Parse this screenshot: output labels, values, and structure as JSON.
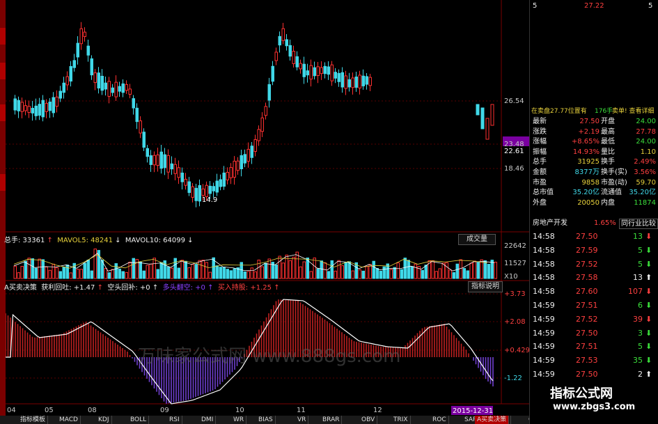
{
  "chart": {
    "price_levels": [
      "26.54",
      "23.48",
      "22.61",
      "18.46"
    ],
    "low_marker": "14.9",
    "date_labels": [
      "04",
      "05",
      "08",
      "09",
      "10",
      "11",
      "12"
    ],
    "date_badge": "2015-12-31",
    "bottom_tag": "A买卖决策",
    "mini_marks": [
      "111",
      "175",
      "208"
    ]
  },
  "volume_panel": {
    "total_label": "总手: 33361",
    "mavol5": "MAVOL5: 48241",
    "mavol10": "MAVOL10: 64099",
    "button": "成交量",
    "levels": [
      "22642",
      "11527",
      "X10"
    ]
  },
  "indicator_panel": {
    "name": "A买卖决策",
    "profit": "获利回吐: +1.47",
    "short": "空头回补: +0",
    "bull": "多头翻空: +0",
    "buy": "买入持股: +1.25",
    "button": "指标说明",
    "levels": [
      "+3.73",
      "+2.08",
      "+0.429",
      "-1.22"
    ],
    "watermark": "万味家公式网 www.888gs.com"
  },
  "bottom_tabs": [
    "指标模板",
    "MACD",
    "KDJ",
    "BOLL",
    "RSI",
    "DMI",
    "WR",
    "BIAS",
    "VR",
    "BRAR",
    "OBV",
    "TRIX",
    "ROC",
    "SAR",
    "PSY",
    "CCI",
    "ASI"
  ],
  "quote": {
    "top_left": "5",
    "top_mid": "27.22",
    "top_right": "5",
    "sell_pending": "在卖盘27.77位置有",
    "sell_hands": "176手",
    "sell_tail": "卖单! 查看详细",
    "rows": [
      {
        "l": "最新",
        "v": "27.50",
        "l2": "开盘",
        "v2": "24.00"
      },
      {
        "l": "涨跌",
        "v": "+2.19",
        "l2": "最高",
        "v2": "27.78"
      },
      {
        "l": "涨幅",
        "v": "+8.65%",
        "l2": "最低",
        "v2": "24.00"
      },
      {
        "l": "振幅",
        "v": "14.93%",
        "l2": "量比",
        "v2": "1.10"
      },
      {
        "l": "总手",
        "v": "31925",
        "l2": "换手",
        "v2": "2.49%"
      },
      {
        "l": "金额",
        "v": "8377万",
        "l2": "换手(实)",
        "v2": "3.56%"
      },
      {
        "l": "市盈",
        "v": "9858",
        "l2": "市盈(动)",
        "v2": "59.70"
      },
      {
        "l": "总市值",
        "v": "35.20亿",
        "l2": "流通值",
        "v2": "35.20亿"
      },
      {
        "l": "外盘",
        "v": "20050",
        "l2": "内盘",
        "v2": "11874"
      }
    ],
    "sector": "房地产开发",
    "sector_pct": "1.65%",
    "sector_btn": "同行业比较"
  },
  "trades": [
    {
      "t": "14:58",
      "p": "27.50",
      "v": "13",
      "d": "down"
    },
    {
      "t": "14:58",
      "p": "27.59",
      "v": "5",
      "d": "down"
    },
    {
      "t": "14:58",
      "p": "27.52",
      "v": "5",
      "d": "down"
    },
    {
      "t": "14:58",
      "p": "27.58",
      "v": "13",
      "d": "up"
    },
    {
      "t": "14:58",
      "p": "27.60",
      "v": "107",
      "d": "down"
    },
    {
      "t": "14:59",
      "p": "27.51",
      "v": "6",
      "d": "down"
    },
    {
      "t": "14:59",
      "p": "27.52",
      "v": "39",
      "d": "down"
    },
    {
      "t": "14:59",
      "p": "27.50",
      "v": "3",
      "d": "down"
    },
    {
      "t": "14:59",
      "p": "27.51",
      "v": "5",
      "d": "down"
    },
    {
      "t": "14:59",
      "p": "27.53",
      "v": "35",
      "d": "down"
    },
    {
      "t": "14:59",
      "p": "27.50",
      "v": "2",
      "d": "up"
    },
    {
      "t": "14:59",
      "p": "27.40",
      "v": "47",
      "d": "down"
    },
    {
      "t": "14:59",
      "p": "27.40",
      "v": "4",
      "d": "down"
    }
  ],
  "logo": {
    "title": "指标公式网",
    "url": "www.zbgs3.com"
  }
}
